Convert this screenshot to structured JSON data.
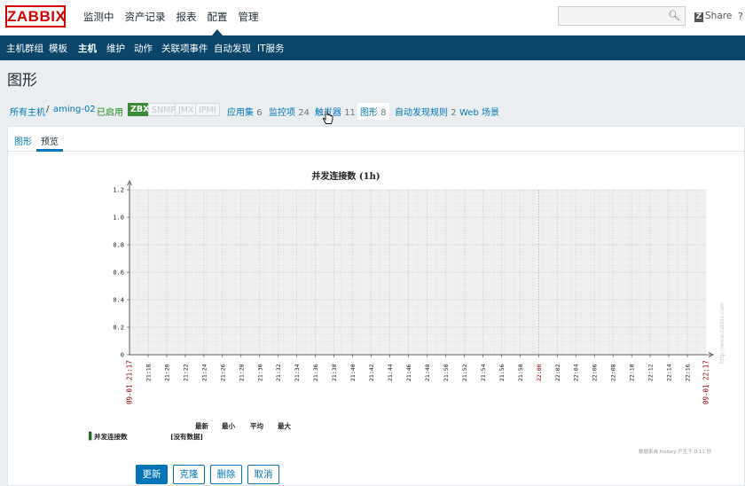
{
  "logo": "ZABBIX",
  "top_menu": [
    "监测中",
    "资产记录",
    "报表",
    "配置",
    "管理"
  ],
  "share_label": "Share",
  "help_label": "?",
  "sub_menu": [
    "主机群组",
    "模板",
    "主机",
    "维护",
    "动作",
    "关联项事件",
    "自动发现",
    "IT服务"
  ],
  "page_title": "图形",
  "host_nav": {
    "all_hosts": "所有主机",
    "separator": "/",
    "host": "aming-02",
    "status": "已启用",
    "interfaces": [
      "ZBX",
      "SNMP",
      "JMX",
      "IPMI"
    ],
    "applications": {
      "label": "应用集",
      "count": "6"
    },
    "items": {
      "label": "监控项",
      "count": "24"
    },
    "triggers": {
      "label": "触发器",
      "count": "11"
    },
    "graphs": {
      "label": "图形",
      "count": "8"
    },
    "discovery": {
      "label": "自动发现规则",
      "count": "2"
    },
    "web": "Web 场景"
  },
  "tabs": [
    "图形",
    "预览"
  ],
  "chart_data": {
    "type": "line",
    "title": "并发连接数 (1h)",
    "y_ticks": [
      "1.2",
      "1.0",
      "0.8",
      "0.6",
      "0.4",
      "0.2",
      "0"
    ],
    "ylim": [
      0,
      1.2
    ],
    "x_start_label": "09-01 21:17",
    "x_end_label": "09-01 22:17",
    "x_ticks": [
      "21:18",
      "21:20",
      "21:22",
      "21:24",
      "21:26",
      "21:28",
      "21:30",
      "21:32",
      "21:34",
      "21:36",
      "21:38",
      "21:40",
      "21:42",
      "21:44",
      "21:46",
      "21:48",
      "21:50",
      "21:52",
      "21:54",
      "21:56",
      "21:58",
      "22:00",
      "22:02",
      "22:04",
      "22:06",
      "22:08",
      "22:10",
      "22:12",
      "22:14",
      "22:16"
    ],
    "highlight_ticks": [
      "22:00"
    ],
    "legend_headers": [
      "最新",
      "最小",
      "平均",
      "最大"
    ],
    "series": [
      {
        "name": "并发连接数",
        "color": "#1a7a1a",
        "status": "[没有数据]",
        "values": []
      }
    ],
    "grid": true,
    "watermark": "http://www.zabbix.com",
    "footer_note": "数据来自 history   产生于 0.11 秒"
  },
  "buttons": [
    "更新",
    "克隆",
    "删除",
    "取消"
  ],
  "colors": {
    "accent": "#0275b8",
    "nav_dark": "#0a466a",
    "logo_red": "#d40000",
    "status_green": "#1e8a19"
  }
}
